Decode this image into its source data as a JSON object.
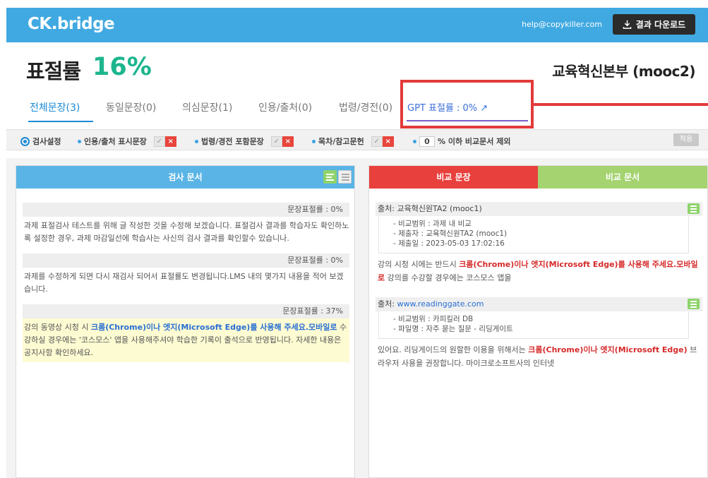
{
  "header": {
    "logo": "CK.bridge",
    "email": "help@copykiller.com",
    "download_label": "결과 다운로드"
  },
  "summary": {
    "rate_label": "표절률",
    "rate_value": "16%",
    "org": "교육혁신본부 (mooc2)"
  },
  "tabs": [
    {
      "label": "전체문장(3)",
      "active": true
    },
    {
      "label": "동일문장(0)"
    },
    {
      "label": "의심문장(1)"
    },
    {
      "label": "인용/출처(0)"
    },
    {
      "label": "법령/경전(0)"
    }
  ],
  "gpt_tab": {
    "label": "GPT 표절률 : 0% ↗"
  },
  "settings": {
    "title": "검사설정",
    "opt1": "인용/출처 표시문장",
    "opt2": "법령/경전 포함문장",
    "opt3": "목차/참고문헌",
    "threshold_value": "0",
    "threshold_label": "% 이하 비교문서 제외",
    "apply": "적용",
    "ok_mark": "✓",
    "no_mark": "×"
  },
  "left_panel": {
    "title": "검사 문서",
    "sentences": [
      {
        "rate": "문장표절률 : 0%",
        "text": "과제 표절검사 테스트를 위해 글 작성한 것을 수정해 보겠습니다. 표절검사 결과를 학습자도 확인하노록 설정한 경우, 과제 마감일선에 학습사는 사신의 검사 결과를 확인할수 있습니나."
      },
      {
        "rate": "문장표절률 : 0%",
        "text": "과제를 수정하게 되면 다시 재검사 되어서 표절률도 변경됩니다.LMS 내의 몇가지 내용을 적어 보겠습니다."
      },
      {
        "rate": "문장표절률 : 37%",
        "text_pre": "강의 동영상 시청 시 ",
        "text_hl": "크롬(Chrome)이나 엣지(Microsoft Edge)를 사용해 주세요.모바일로",
        "text_post": " 수강하실 경우에는 '코스모스' 앱을 사용해주셔야 학습한 기록이 출석으로 반영됩니다. 자세한 내용은 공지사항 확인하세요."
      }
    ]
  },
  "right_panel": {
    "tab_compare_sentence": "비교 문장",
    "tab_compare_doc": "비교 문서",
    "sources": [
      {
        "source_label": "출처: ",
        "source_name": "교육혁신원TA2 (mooc1)",
        "meta": [
          "- 비교범위 : 과제 내 비교",
          "- 제출자 : 교육혁신원TA2 (mooc1)",
          "- 제출일 : 2023-05-03 17:02:16"
        ],
        "text_pre": "강의 시청 시에는 반드시 ",
        "text_hl": "크롬(Chrome)이나 엣지(Microsoft Edge)를 사용해 주세요.모바일로",
        "text_post": " 강의를 수강할 경우에는 코스모스 앱을"
      },
      {
        "source_label": "출처: ",
        "source_name": "www.readinggate.com",
        "meta": [
          "- 비교범위 : 카피킬러 DB",
          "- 파일명 : 자주 묻는 질문 - 리딩게이트"
        ],
        "text_pre": "있어요. 리딩게이드의 원할한 이용을 위해서는 ",
        "text_hl": "크롬(Chrome)이나 엣지(Microsoft Edge)",
        "text_post": " 브라우저 사용을 권장합니다. 마이크로소프트사의 인터넷"
      }
    ]
  },
  "colors": {
    "topbar": "#41a9e1",
    "rate": "#1cb58e",
    "highlight_red": "#e23a3a",
    "compare_red": "#e8403d",
    "compare_green": "#a4d36f"
  }
}
